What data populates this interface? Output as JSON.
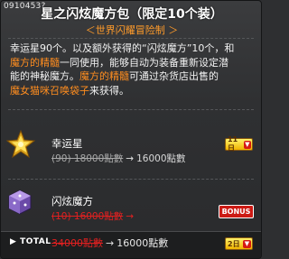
{
  "header": {
    "item_code": "0910453?",
    "title": "星之闪炫魔方包（限定10个装）",
    "subtitle": "＜世界闪耀冒险制 ＞"
  },
  "description": {
    "p1": "幸运星90个。以及额外获得的“闪炫魔方”10个，和",
    "hl1": "魔方的精髓",
    "p2": "一同使用，能够自动为装备重新设定潜",
    "p3": "能的神秘魔方。",
    "hl2": "魔方的精髓",
    "p4": "可通过杂货店出售的",
    "hl3": "魔女猫咪召唤袋子",
    "p5": "来获得。"
  },
  "items": [
    {
      "name": "幸运星",
      "old_price": "(90) 18000點數",
      "new_price": "16000點數",
      "badge": "11日"
    },
    {
      "name": "闪炫魔方",
      "old_price": "(10) 16000點數",
      "new_price": "",
      "badge": "BONUS"
    }
  ],
  "total": {
    "label": "TOTAL",
    "old_price": "34000點數",
    "new_price": "16000點數",
    "badge": "2日"
  },
  "icons": {
    "arrow": "→",
    "down": "▼",
    "bullet": "▶"
  },
  "colors": {
    "background": "#2e2f31",
    "highlight": "#ff8d1f",
    "strike_red": "#e02020",
    "badge_yellow": "#f0b400",
    "bonus_red": "#cc1a14"
  }
}
